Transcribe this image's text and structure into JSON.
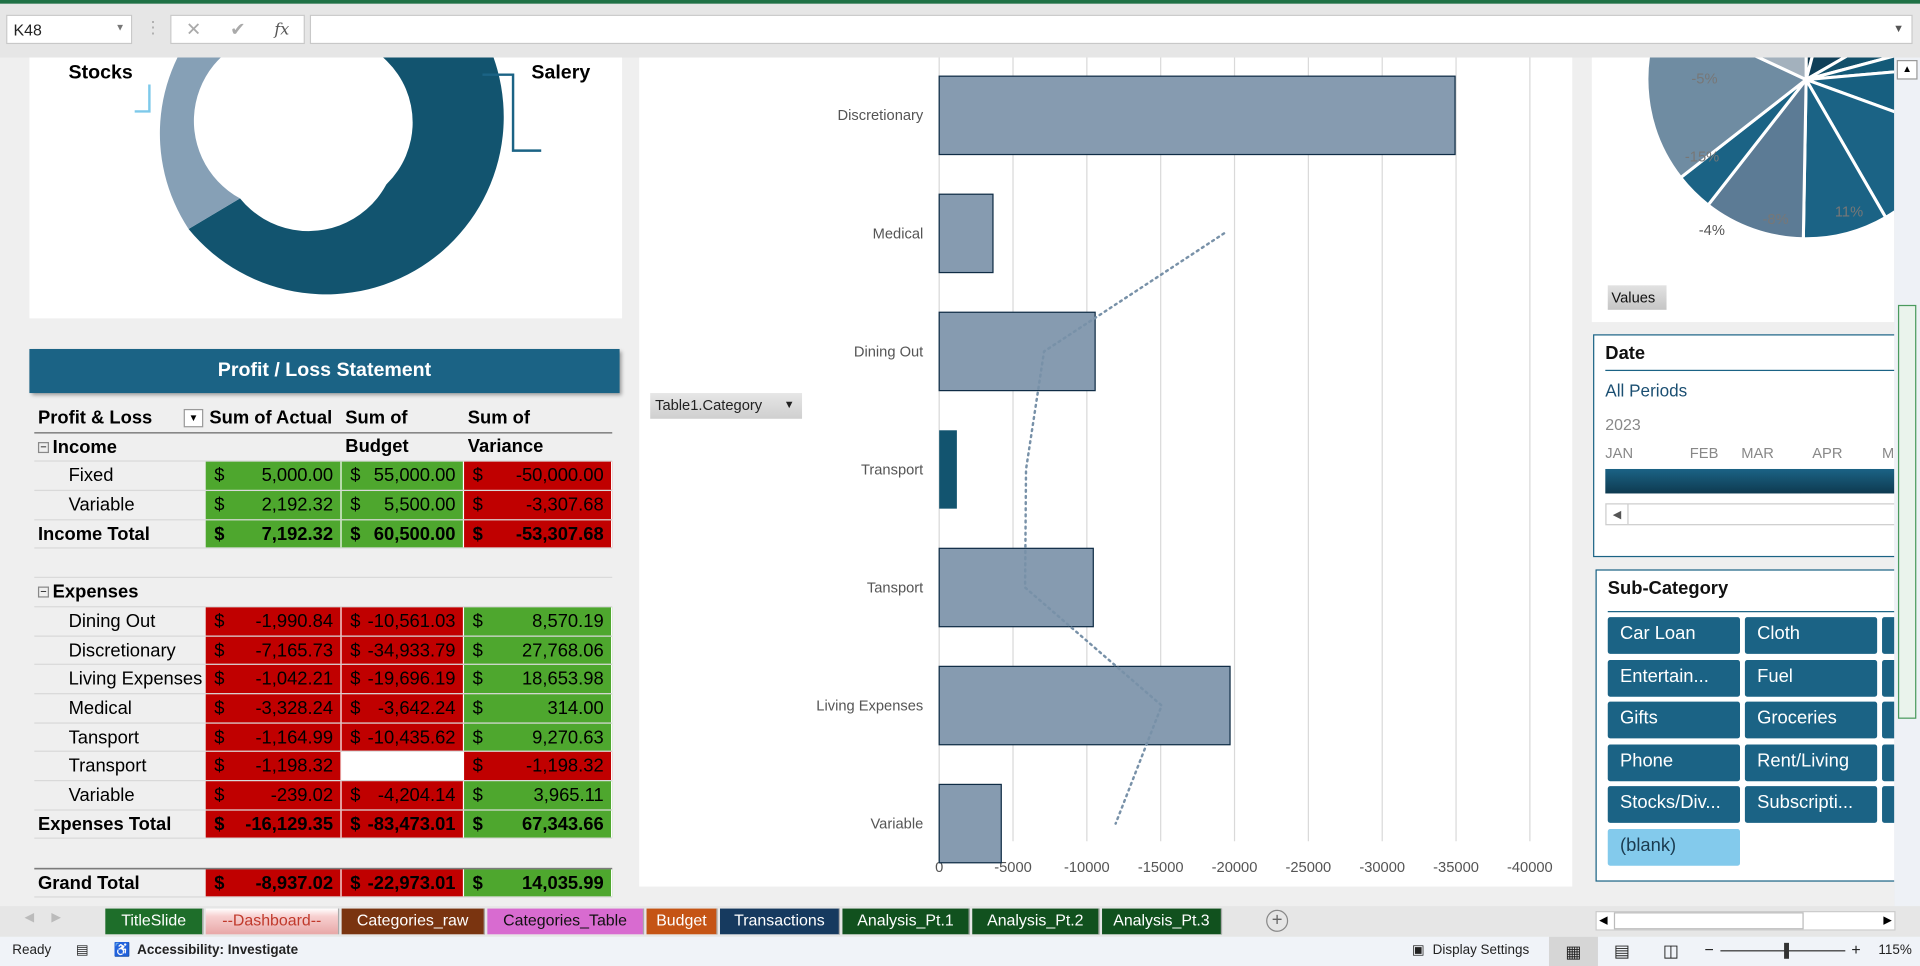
{
  "formula_bar": {
    "name_box": "K48",
    "cancel_icon": "✕",
    "enter_icon": "✔",
    "fx_label": "fx",
    "value": ""
  },
  "donut": {
    "labels": [
      "Stocks",
      "Salery"
    ],
    "colors": [
      "#86a0b6",
      "#12546f",
      "#7dc9ea"
    ]
  },
  "pl": {
    "title": "Profit / Loss Statement",
    "headers": [
      "Profit & Loss",
      "Sum of Actual",
      "Sum of Budget",
      "Sum of Variance"
    ],
    "rows": [
      {
        "label": "Income",
        "type": "group"
      },
      {
        "label": "Fixed",
        "type": "item",
        "actual": "5,000.00",
        "budget": "55,000.00",
        "variance": "-50,000.00",
        "colors": [
          "g",
          "g",
          "r"
        ]
      },
      {
        "label": "Variable",
        "type": "item",
        "actual": "2,192.32",
        "budget": "5,500.00",
        "variance": "-3,307.68",
        "colors": [
          "g",
          "g",
          "r"
        ]
      },
      {
        "label": "Income Total",
        "type": "total",
        "actual": "7,192.32",
        "budget": "60,500.00",
        "variance": "-53,307.68",
        "colors": [
          "g",
          "g",
          "r"
        ]
      },
      {
        "label": "",
        "type": "blank"
      },
      {
        "label": "Expenses",
        "type": "group"
      },
      {
        "label": "Dining Out",
        "type": "item",
        "actual": "-1,990.84",
        "budget": "-10,561.03",
        "variance": "8,570.19",
        "colors": [
          "r",
          "r",
          "g"
        ]
      },
      {
        "label": "Discretionary",
        "type": "item",
        "actual": "-7,165.73",
        "budget": "-34,933.79",
        "variance": "27,768.06",
        "colors": [
          "r",
          "r",
          "g"
        ]
      },
      {
        "label": "Living Expenses",
        "type": "item",
        "actual": "-1,042.21",
        "budget": "-19,696.19",
        "variance": "18,653.98",
        "colors": [
          "r",
          "r",
          "g"
        ]
      },
      {
        "label": "Medical",
        "type": "item",
        "actual": "-3,328.24",
        "budget": "-3,642.24",
        "variance": "314.00",
        "colors": [
          "r",
          "r",
          "g"
        ]
      },
      {
        "label": "Tansport",
        "type": "item",
        "actual": "-1,164.99",
        "budget": "-10,435.62",
        "variance": "9,270.63",
        "colors": [
          "r",
          "r",
          "g"
        ]
      },
      {
        "label": "Transport",
        "type": "item",
        "actual": "-1,198.32",
        "budget": null,
        "variance": "-1,198.32",
        "colors": [
          "r",
          "w",
          "r"
        ]
      },
      {
        "label": "Variable",
        "type": "item",
        "actual": "-239.02",
        "budget": "-4,204.14",
        "variance": "3,965.11",
        "colors": [
          "r",
          "r",
          "g"
        ]
      },
      {
        "label": "Expenses Total",
        "type": "total",
        "actual": "-16,129.35",
        "budget": "-83,473.01",
        "variance": "67,343.66",
        "colors": [
          "r",
          "r",
          "g"
        ]
      },
      {
        "label": "",
        "type": "blank"
      },
      {
        "label": "Grand Total",
        "type": "grand",
        "actual": "-8,937.02",
        "budget": "-22,973.01",
        "variance": "14,035.99",
        "colors": [
          "r",
          "r",
          "g"
        ]
      }
    ],
    "currency": "$",
    "colors": {
      "g": "#4ea72e",
      "r": "#c00000",
      "w": "#ffffff"
    }
  },
  "category_filter": {
    "label": "Table1.Category"
  },
  "chart_data": {
    "type": "bar",
    "orientation": "horizontal",
    "categories": [
      "Discretionary",
      "Medical",
      "Dining Out",
      "Transport",
      "Tansport",
      "Living Expenses",
      "Variable"
    ],
    "values": [
      -34933.79,
      -3642.24,
      -10561.03,
      -1198.32,
      -10435.62,
      -19696.19,
      -4204.14
    ],
    "bar_colors": [
      "#869bb0",
      "#869bb0",
      "#869bb0",
      "#12546f",
      "#869bb0",
      "#869bb0",
      "#869bb0"
    ],
    "xlim": [
      0,
      -40000
    ],
    "xticks": [
      "0",
      "-5000",
      "-10000",
      "-15000",
      "-20000",
      "-25000",
      "-30000",
      "-35000",
      "-40000"
    ],
    "grid": true,
    "trendline": "dotted moving average"
  },
  "pie": {
    "labels": [
      "-5%",
      "-15%",
      "-4%",
      "-8%",
      "11%"
    ],
    "button": "Values"
  },
  "date_slicer": {
    "title": "Date",
    "period": "All Periods",
    "year": "2023",
    "months": [
      "JAN",
      "FEB",
      "MAR",
      "APR",
      "M"
    ]
  },
  "sub_slicer": {
    "title": "Sub-Category",
    "items": [
      "Car Loan",
      "Cloth",
      "Entertain...",
      "Fuel",
      "Gifts",
      "Groceries",
      "Phone",
      "Rent/Living",
      "Stocks/Div...",
      "Subscripti...",
      "(blank)"
    ]
  },
  "tabs": [
    {
      "label": "TitleSlide",
      "bg": "#1e6e2a",
      "fg": "#ffffff"
    },
    {
      "label": "--Dashboard--",
      "bg": "#f2b8b8",
      "fg": "#c0392b",
      "active": true
    },
    {
      "label": "Categories_raw",
      "bg": "#7a3410",
      "fg": "#ffffff"
    },
    {
      "label": "Categories_Table",
      "bg": "#d86bd0",
      "fg": "#111111"
    },
    {
      "label": "Budget",
      "bg": "#c55415",
      "fg": "#ffffff"
    },
    {
      "label": "Transactions",
      "bg": "#163a5f",
      "fg": "#ffffff"
    },
    {
      "label": "Analysis_Pt.1",
      "bg": "#11511e",
      "fg": "#ffffff"
    },
    {
      "label": "Analysis_Pt.2",
      "bg": "#11511e",
      "fg": "#ffffff"
    },
    {
      "label": "Analysis_Pt.3",
      "bg": "#11511e",
      "fg": "#ffffff"
    }
  ],
  "status": {
    "ready": "Ready",
    "accessibility": "Accessibility: Investigate",
    "display_settings": "Display Settings",
    "zoom": "115%"
  }
}
